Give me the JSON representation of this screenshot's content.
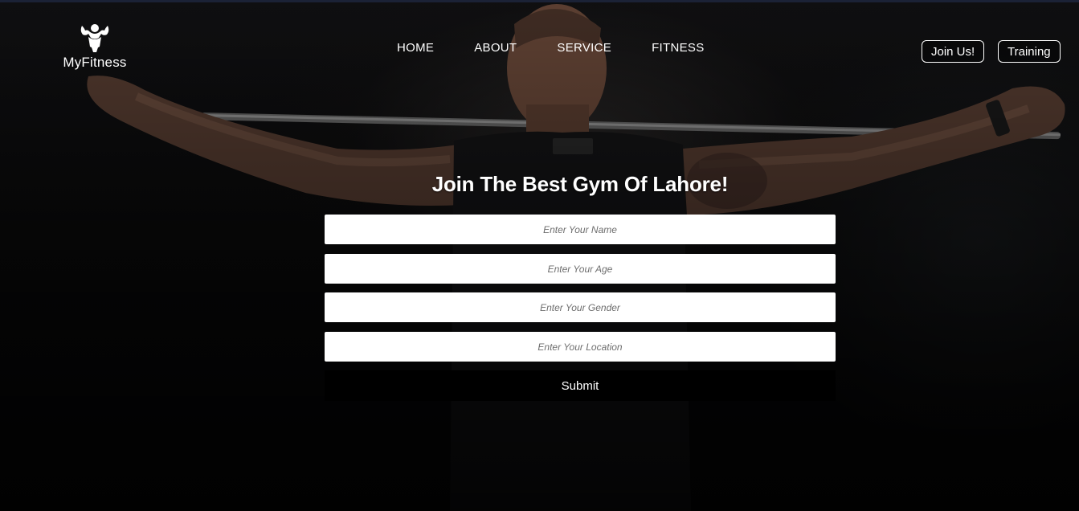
{
  "brand": {
    "name": "MyFitness",
    "logo_icon": "bodybuilder-icon"
  },
  "nav": {
    "items": [
      {
        "label": "HOME"
      },
      {
        "label": "ABOUT"
      },
      {
        "label": "SERVICE"
      },
      {
        "label": "FITNESS"
      }
    ],
    "join_label": "Join Us!",
    "training_label": "Training"
  },
  "form": {
    "heading": "Join The Best Gym Of Lahore!",
    "name_placeholder": "Enter Your Name",
    "age_placeholder": "Enter Your Age",
    "gender_placeholder": "Enter Your Gender",
    "location_placeholder": "Enter Your Location",
    "submit_label": "Submit"
  },
  "colors": {
    "background": "#050506",
    "text": "#ffffff",
    "field": "#ffffff",
    "submit": "#000000"
  }
}
